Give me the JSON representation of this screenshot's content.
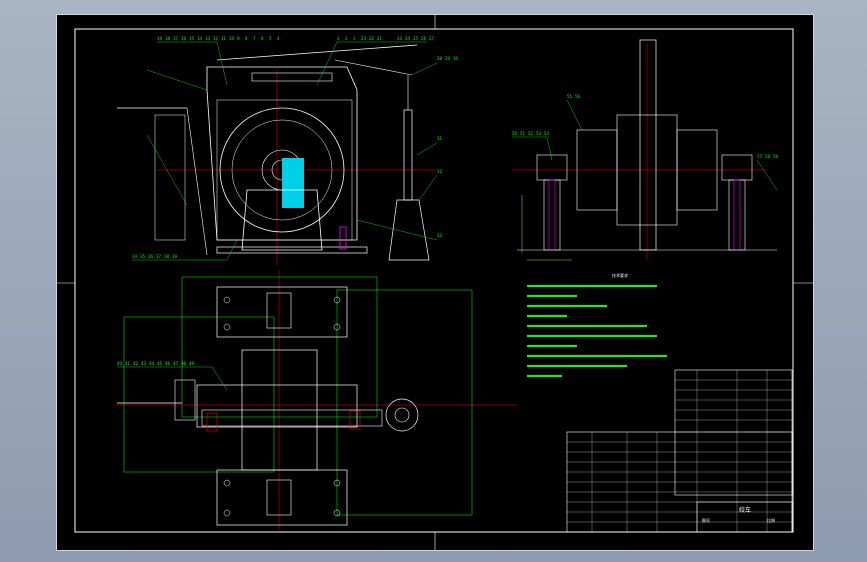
{
  "drawing": {
    "title_block_label": "图号",
    "part_name": "绞车",
    "scale_label": "比例",
    "tech_requirements_title": "技术要求"
  },
  "colors": {
    "background": "#000000",
    "outline": "#ffffff",
    "leader": "#00ff00",
    "centerline": "#ff0000",
    "hatch": "#00e5ff",
    "hidden": "#ff00ff",
    "dimension": "#ffff00"
  },
  "balloons_front": [
    "19",
    "18",
    "17",
    "16",
    "15",
    "14",
    "13",
    "12",
    "11",
    "10",
    "9",
    "8",
    "7",
    "6",
    "5",
    "4",
    "3",
    "2",
    "1",
    "23",
    "22",
    "21",
    "20",
    "24",
    "25",
    "26",
    "27",
    "28",
    "29",
    "30",
    "31",
    "32",
    "33",
    "34",
    "35",
    "36",
    "37",
    "38",
    "39"
  ],
  "balloons_side": [
    "50",
    "51",
    "52",
    "53",
    "54",
    "55",
    "56",
    "57",
    "58",
    "59"
  ],
  "balloons_plan": [
    "40",
    "41",
    "42",
    "43",
    "44",
    "45",
    "46",
    "47",
    "48",
    "49"
  ]
}
